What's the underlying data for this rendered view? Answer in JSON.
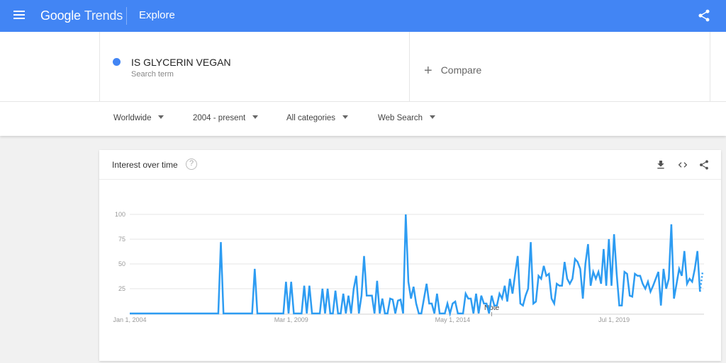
{
  "header": {
    "logo_google": "Google",
    "logo_trends": "Trends",
    "section": "Explore"
  },
  "search_term": {
    "name": "IS GLYCERIN VEGAN",
    "subtitle": "Search term",
    "color": "#4285f4"
  },
  "compare": {
    "label": "Compare",
    "icon": "+"
  },
  "filters": [
    {
      "label": "Worldwide"
    },
    {
      "label": "2004 - present"
    },
    {
      "label": "All categories"
    },
    {
      "label": "Web Search"
    }
  ],
  "card": {
    "title": "Interest over time",
    "help_icon": "?",
    "actions": [
      "download-icon",
      "embed-icon",
      "share-icon"
    ]
  },
  "chart_data": {
    "type": "line",
    "title": "Interest over time",
    "xlabel": "",
    "ylabel": "",
    "ylim": [
      0,
      100
    ],
    "yticks": [
      25,
      50,
      75,
      100
    ],
    "grid": true,
    "x_start": "Jan 2004",
    "x_interval": "monthly",
    "xtick_labels": [
      {
        "label": "Jan 1, 2004",
        "index": 0
      },
      {
        "label": "Mar 1, 2009",
        "index": 62
      },
      {
        "label": "May 1, 2014",
        "index": 124
      },
      {
        "label": "Jul 1, 2019",
        "index": 186
      }
    ],
    "annotation": {
      "label": "Note",
      "index": 139
    },
    "partial_last_point": true,
    "series": [
      {
        "name": "IS GLYCERIN VEGAN",
        "color": "#2d9cf2",
        "values": [
          0,
          0,
          0,
          0,
          0,
          0,
          0,
          0,
          0,
          0,
          0,
          0,
          0,
          0,
          0,
          0,
          0,
          0,
          0,
          0,
          0,
          0,
          0,
          0,
          0,
          0,
          0,
          0,
          0,
          0,
          0,
          0,
          0,
          0,
          0,
          72,
          0,
          0,
          0,
          0,
          0,
          0,
          0,
          0,
          0,
          0,
          0,
          0,
          45,
          0,
          0,
          0,
          0,
          0,
          0,
          0,
          0,
          0,
          0,
          0,
          32,
          0,
          32,
          0,
          0,
          0,
          0,
          28,
          0,
          28,
          0,
          0,
          0,
          0,
          25,
          0,
          25,
          0,
          0,
          23,
          0,
          0,
          20,
          0,
          18,
          0,
          25,
          38,
          0,
          18,
          58,
          18,
          18,
          18,
          0,
          33,
          0,
          15,
          0,
          0,
          15,
          14,
          0,
          13,
          14,
          0,
          100,
          32,
          15,
          27,
          10,
          0,
          0,
          15,
          30,
          10,
          10,
          0,
          20,
          0,
          0,
          0,
          10,
          0,
          10,
          12,
          0,
          0,
          0,
          20,
          15,
          15,
          0,
          20,
          0,
          18,
          10,
          10,
          0,
          18,
          8,
          8,
          20,
          15,
          28,
          12,
          35,
          20,
          40,
          58,
          10,
          8,
          18,
          25,
          72,
          10,
          12,
          38,
          35,
          48,
          38,
          40,
          15,
          10,
          30,
          28,
          28,
          52,
          35,
          30,
          35,
          55,
          52,
          45,
          15,
          50,
          70,
          28,
          42,
          35,
          42,
          30,
          65,
          28,
          75,
          28,
          80,
          40,
          8,
          8,
          42,
          40,
          18,
          17,
          40,
          38,
          38,
          30,
          25,
          32,
          22,
          28,
          35,
          42,
          8,
          45,
          25,
          35,
          90,
          15,
          30,
          45,
          38,
          63,
          30,
          35,
          32,
          45,
          63,
          22,
          42
        ]
      }
    ]
  }
}
